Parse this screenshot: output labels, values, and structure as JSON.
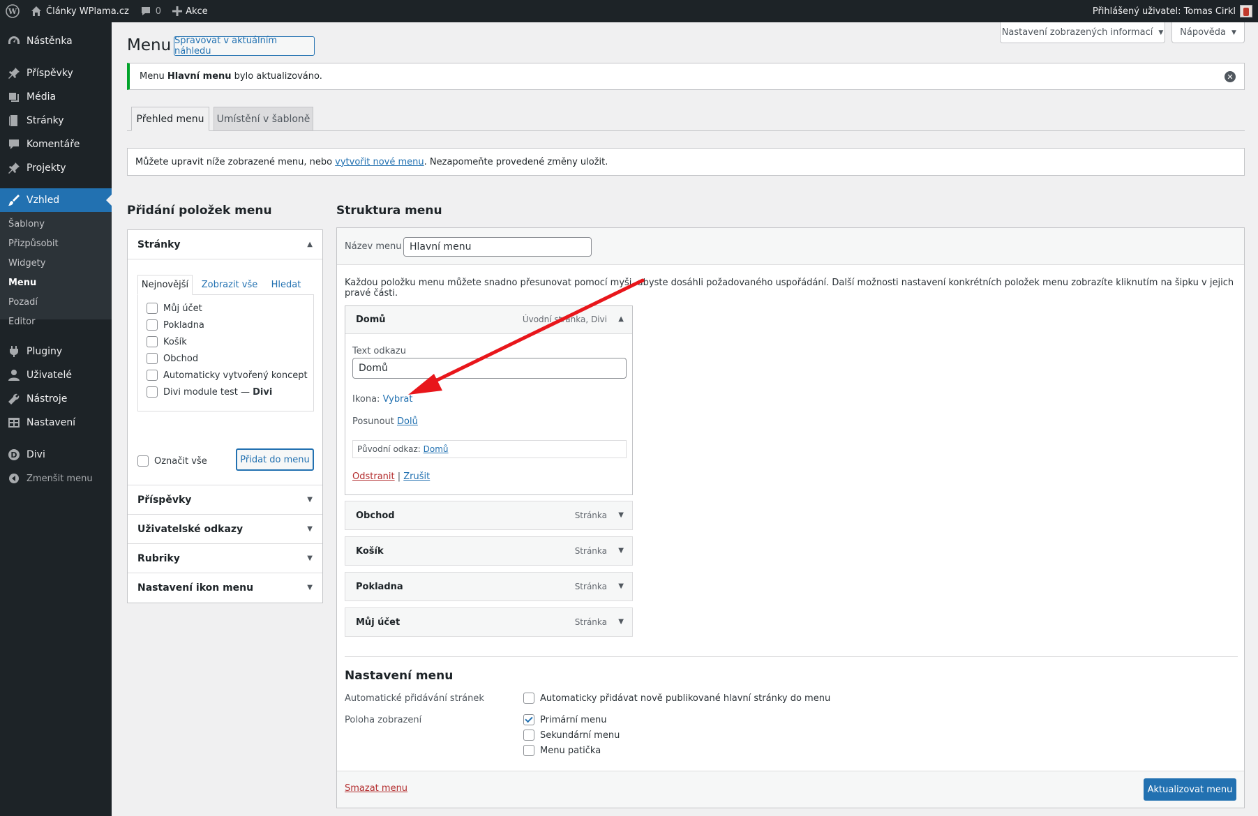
{
  "adminbar": {
    "site_name": "Články WPlama.cz",
    "comments_count": "0",
    "new_label": "Akce",
    "user_greeting": "Přihlášený uživatel: Tomas Cirkl"
  },
  "sidebar": {
    "items": [
      {
        "label": "Nástěnka",
        "icon": "dashboard-icon"
      },
      {
        "label": "Příspěvky",
        "icon": "pin-icon"
      },
      {
        "label": "Média",
        "icon": "media-icon"
      },
      {
        "label": "Stránky",
        "icon": "page-icon"
      },
      {
        "label": "Komentáře",
        "icon": "comment-icon"
      },
      {
        "label": "Projekty",
        "icon": "pin-icon"
      },
      {
        "label": "Vzhled",
        "icon": "brush-icon"
      },
      {
        "label": "Pluginy",
        "icon": "plugin-icon"
      },
      {
        "label": "Uživatelé",
        "icon": "user-icon"
      },
      {
        "label": "Nástroje",
        "icon": "wrench-icon"
      },
      {
        "label": "Nastavení",
        "icon": "settings-icon"
      },
      {
        "label": "Divi",
        "icon": "divi-icon"
      },
      {
        "label": "Zmenšit menu",
        "icon": "collapse-icon"
      }
    ],
    "submenu": [
      "Šablony",
      "Přizpůsobit",
      "Widgety",
      "Menu",
      "Pozadí",
      "Editor"
    ]
  },
  "header": {
    "title": "Menu",
    "live_preview_label": "Spravovat v aktuálním náhledu",
    "screen_options_label": "Nastavení zobrazených informací",
    "help_label": "Nápověda"
  },
  "notice": {
    "prefix": "Menu ",
    "menu_name": "Hlavní menu",
    "suffix": " bylo aktualizováno."
  },
  "tabs": [
    "Přehled menu",
    "Umístění v šabloně"
  ],
  "info": {
    "prefix": "Můžete upravit níže zobrazené menu, nebo ",
    "link": "vytvořit nové menu",
    "suffix": ". Nezapomeňte provedené změny uložit."
  },
  "add_items": {
    "title": "Přidání položek menu",
    "pages_title": "Stránky",
    "subtabs": [
      "Nejnovější",
      "Zobrazit vše",
      "Hledat"
    ],
    "pages": [
      "Můj účet",
      "Pokladna",
      "Košík",
      "Obchod",
      "Automaticky vytvořený koncept"
    ],
    "divi_page_prefix": "Divi module test — ",
    "divi_page_bold": "Divi",
    "select_all_label": "Označit vše",
    "add_button_label": "Přidat do menu",
    "other_sections": [
      "Příspěvky",
      "Uživatelské odkazy",
      "Rubriky",
      "Nastavení ikon menu"
    ]
  },
  "structure": {
    "title": "Struktura menu",
    "menu_name_label": "Název menu",
    "menu_name_value": "Hlavní menu",
    "instructions": "Každou položku menu můžete snadno přesunovat pomocí myši, abyste dosáhli požadovaného uspořádání. Další možnosti nastavení konkrétních položek menu zobrazíte kliknutím na šipku v jejich pravé části.",
    "open_item": {
      "title": "Domů",
      "type": "Úvodní stránka, Divi",
      "link_text_label": "Text odkazu",
      "link_text_value": "Domů",
      "icon_label": "Ikona: ",
      "icon_link": "Vybrat",
      "move_label": "Posunout ",
      "move_link": "Dolů",
      "original_label": "Původní odkaz: ",
      "original_link": "Domů",
      "remove_label": "Odstranit",
      "separator": " | ",
      "cancel_label": "Zrušit"
    },
    "items": [
      {
        "title": "Obchod",
        "type": "Stránka"
      },
      {
        "title": "Košík",
        "type": "Stránka"
      },
      {
        "title": "Pokladna",
        "type": "Stránka"
      },
      {
        "title": "Můj účet",
        "type": "Stránka"
      }
    ],
    "settings_title": "Nastavení menu",
    "auto_add_label": "Automatické přidávání stránek",
    "auto_add_option": "Automaticky přidávat nově publikované hlavní stránky do menu",
    "location_label": "Poloha zobrazení",
    "locations": [
      "Primární menu",
      "Sekundární menu",
      "Menu patička"
    ],
    "delete_label": "Smazat menu",
    "save_label": "Aktualizovat menu"
  },
  "colors": {
    "accent": "#2271b1",
    "admin_dark": "#1d2327",
    "notice_success": "#00a32a",
    "annotation_arrow": "#e8161b",
    "delete_link": "#b32d2e"
  }
}
